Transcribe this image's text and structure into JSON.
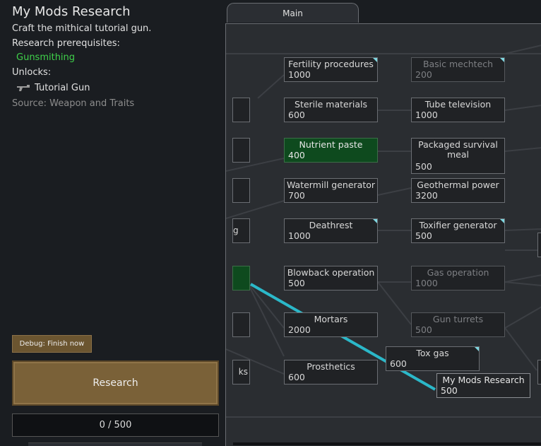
{
  "project": {
    "title": "My Mods Research",
    "description": "Craft the mithical tutorial gun.",
    "prereq_label": "Research prerequisites:",
    "prereq": "Gunsmithing",
    "unlocks_label": "Unlocks:",
    "unlock_item": "Tutorial Gun",
    "source": "Source:  Weapon and Traits",
    "debug_label": "Debug: Finish now",
    "research_label": "Research",
    "progress": "0 / 500"
  },
  "tabs": {
    "main": "Main"
  },
  "nodes": {
    "fertility": {
      "name": "Fertility procedures",
      "cost": "1000"
    },
    "basicmech": {
      "name": "Basic mechtech",
      "cost": "200"
    },
    "sterile": {
      "name": "Sterile materials",
      "cost": "600"
    },
    "tubetv": {
      "name": "Tube television",
      "cost": "1000"
    },
    "nutrient": {
      "name": "Nutrient paste",
      "cost": "400"
    },
    "packaged": {
      "name": "Packaged survival meal",
      "cost": "500"
    },
    "watermill": {
      "name": "Watermill generator",
      "cost": "700"
    },
    "geothermal": {
      "name": "Geothermal power",
      "cost": "3200"
    },
    "deathrest": {
      "name": "Deathrest",
      "cost": "1000"
    },
    "toxifier": {
      "name": "Toxifier generator",
      "cost": "500"
    },
    "blowback": {
      "name": "Blowback operation",
      "cost": "500"
    },
    "gasop": {
      "name": "Gas operation",
      "cost": "1000"
    },
    "mortars": {
      "name": "Mortars",
      "cost": "2000"
    },
    "gunturrets": {
      "name": "Gun turrets",
      "cost": "500"
    },
    "toxgas": {
      "name": "Tox gas",
      "cost": "600"
    },
    "prosthetics": {
      "name": "Prosthetics",
      "cost": "600"
    },
    "mymods": {
      "name": "My Mods Research",
      "cost": "500"
    }
  },
  "stubs": {
    "g": "g",
    "ks": "ks"
  },
  "colors": {
    "prereq_green": "#3fd14a",
    "highlight_cyan": "#2bb8c9",
    "finished": "#0e4a1e"
  }
}
